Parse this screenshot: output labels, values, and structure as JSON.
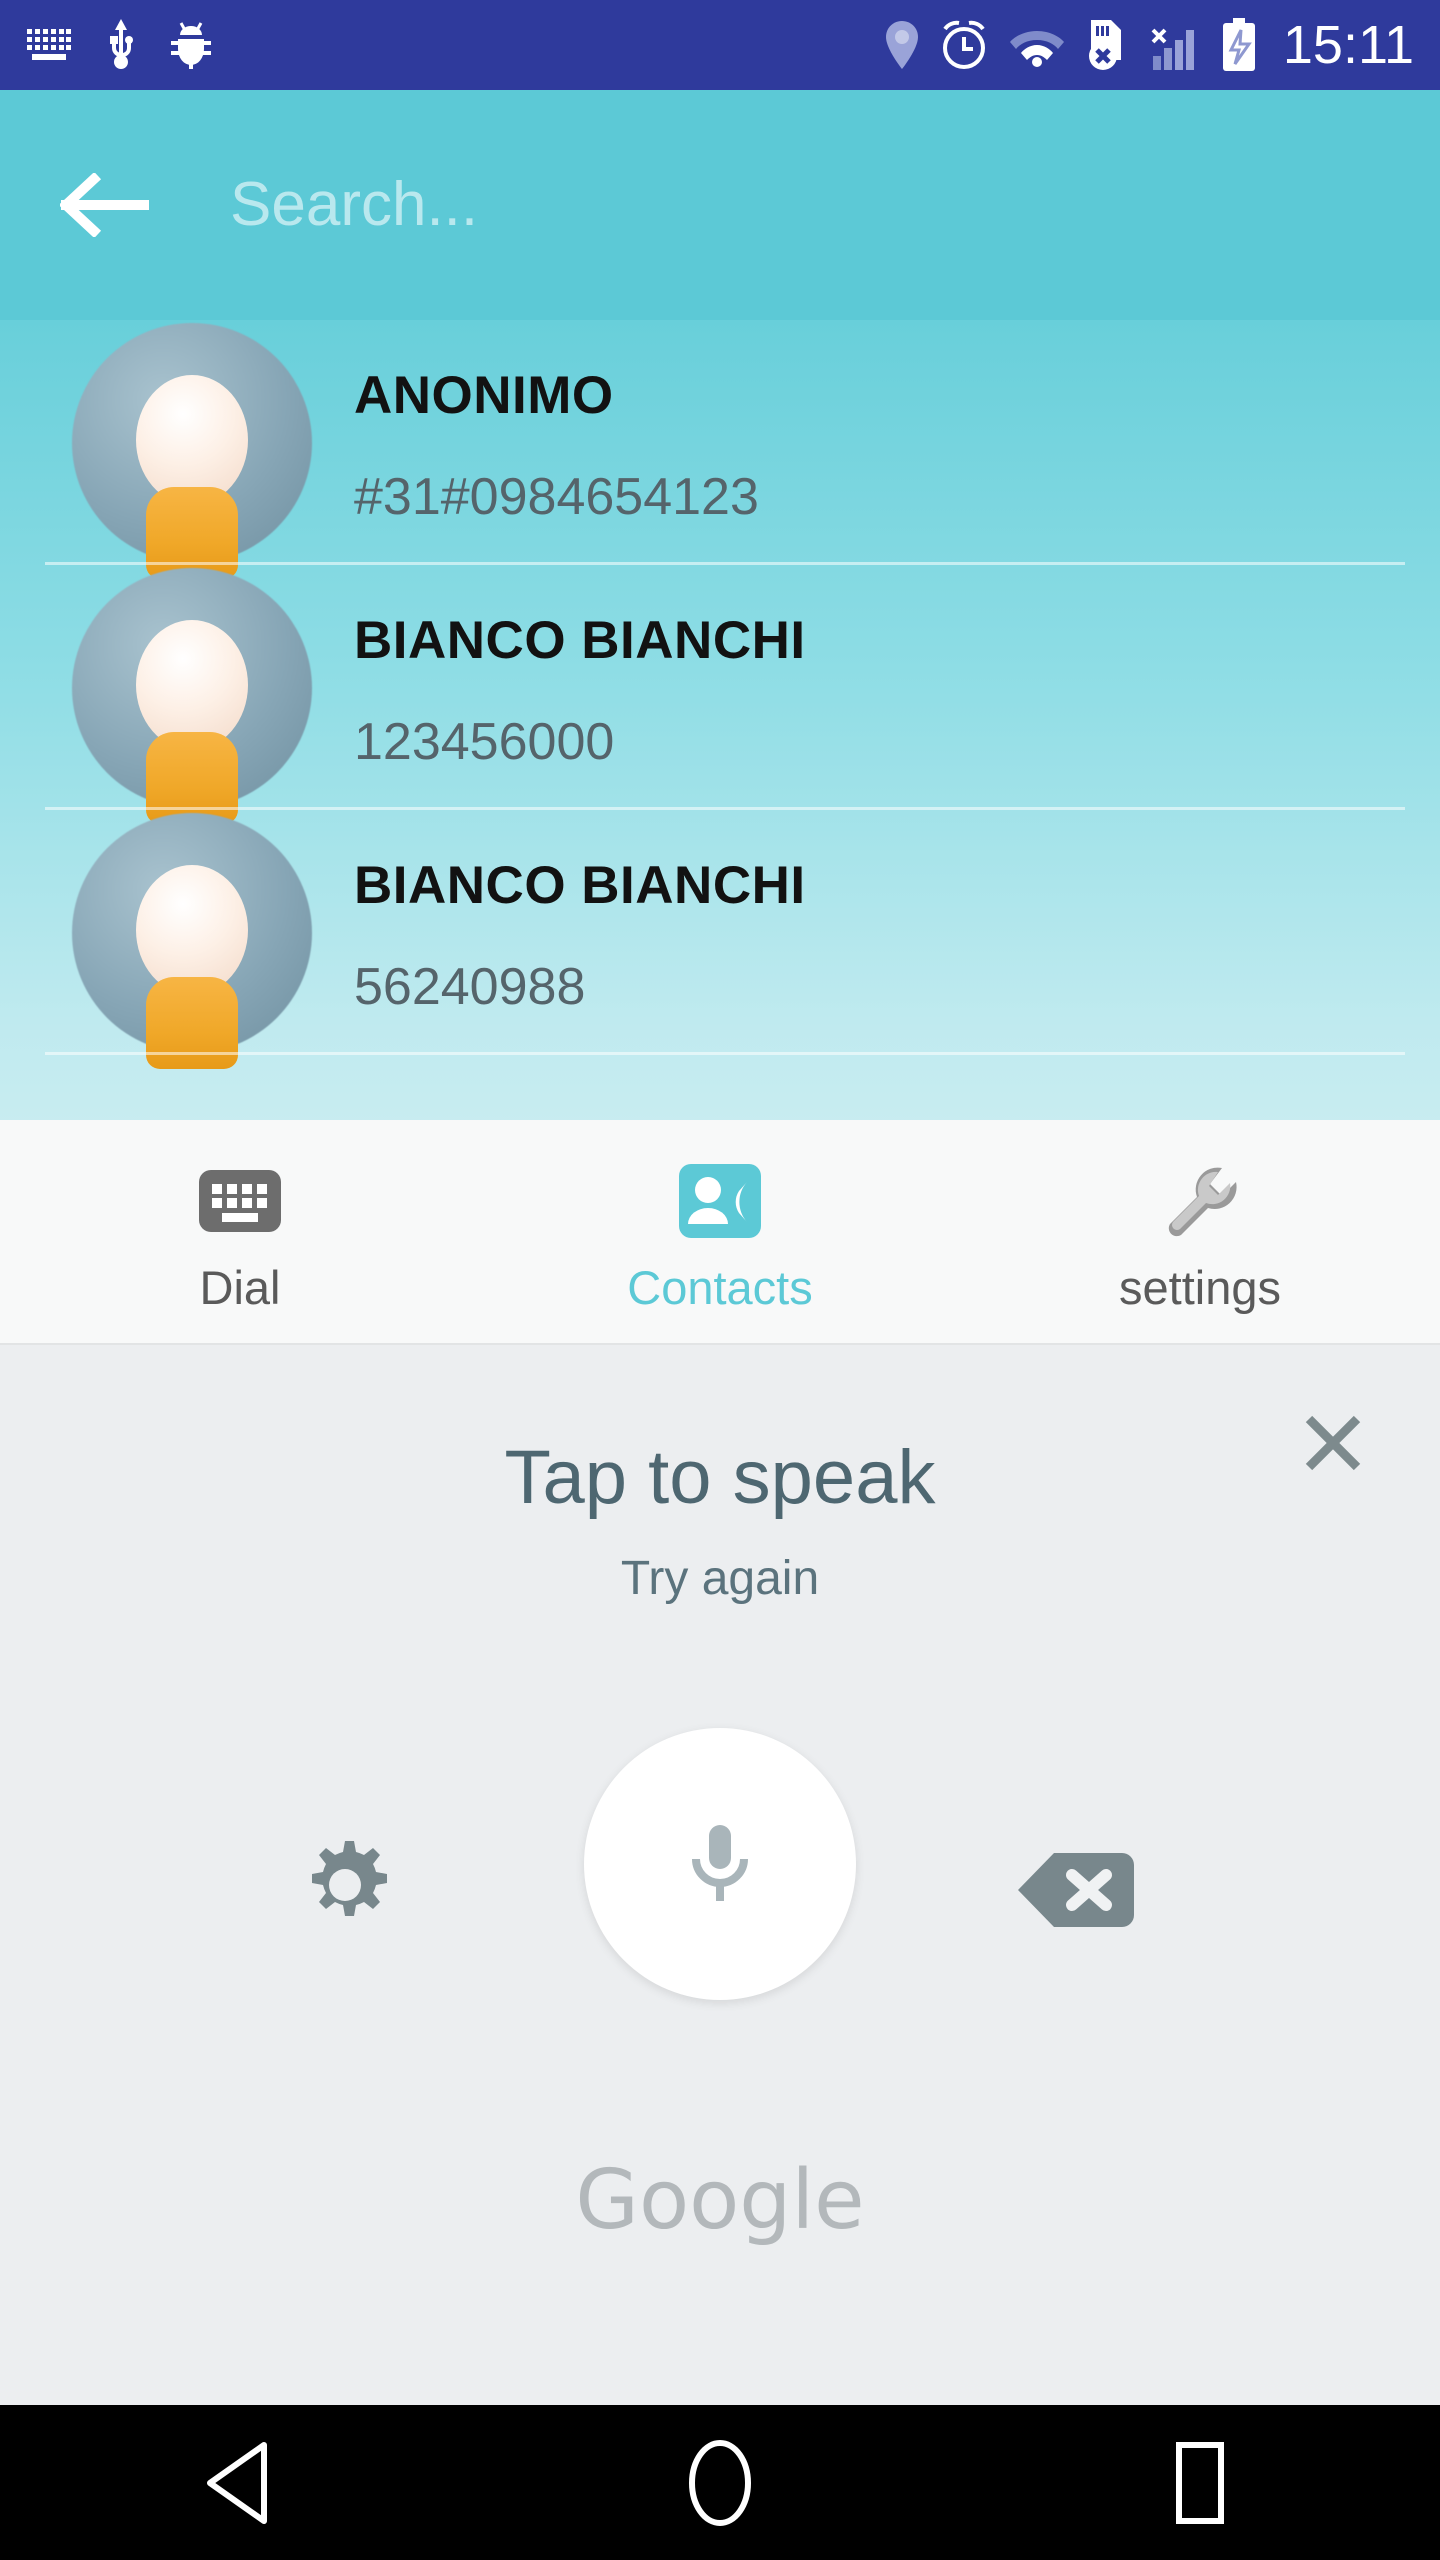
{
  "status_bar": {
    "background_color": "#2f3a9c",
    "time": "15:11",
    "left_icons": [
      {
        "name": "keyboard-icon",
        "label": "keyboard"
      },
      {
        "name": "usb-icon",
        "label": "usb"
      },
      {
        "name": "bug-icon",
        "label": "developer bug"
      }
    ],
    "right_icons": [
      {
        "name": "location-icon",
        "label": "location"
      },
      {
        "name": "alarm-icon",
        "label": "alarm"
      },
      {
        "name": "wifi-icon",
        "label": "wifi"
      },
      {
        "name": "sim-error-icon",
        "label": "sim card error"
      },
      {
        "name": "signal-icon",
        "label": "cellular signal"
      },
      {
        "name": "battery-charging-icon",
        "label": "battery charging"
      }
    ]
  },
  "search": {
    "placeholder": "Search...",
    "value": "",
    "back_label": "Back",
    "background_color": "#5cc9d6",
    "placeholder_color": "#b9e8ee"
  },
  "contacts": [
    {
      "name": "ANONIMO",
      "number": "#31#0984654123"
    },
    {
      "name": "BIANCO BIANCHI",
      "number": "123456000"
    },
    {
      "name": "BIANCO BIANCHI",
      "number": "56240988"
    }
  ],
  "tabs": [
    {
      "id": "dial",
      "label": "Dial",
      "icon": "keypad-icon",
      "active": false
    },
    {
      "id": "contacts",
      "label": "Contacts",
      "icon": "contact-card-icon",
      "active": true
    },
    {
      "id": "settings",
      "label": "settings",
      "icon": "wrench-icon",
      "active": false
    }
  ],
  "tab_active_color": "#5cc9d6",
  "tab_inactive_color": "#5a5a5a",
  "voice_panel": {
    "title": "Tap to speak",
    "subtitle": "Try again",
    "brand": "Google",
    "close_label": "Close",
    "mic_label": "Microphone",
    "settings_label": "Voice settings",
    "backspace_label": "Delete",
    "background_color": "#eceef0",
    "title_color": "#4e6771"
  },
  "navigation_bar": {
    "back_label": "Back",
    "home_label": "Home",
    "recents_label": "Recents"
  }
}
